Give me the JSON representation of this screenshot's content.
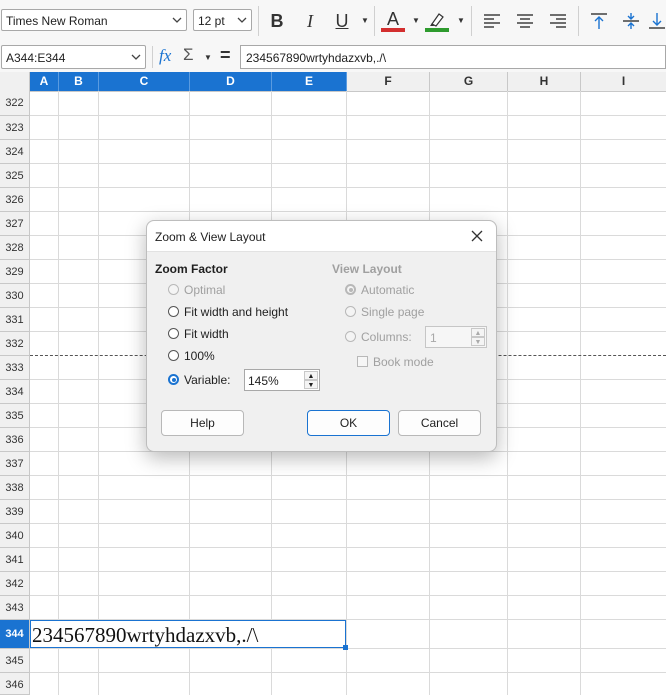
{
  "toolbar": {
    "font_name": "Times New Roman",
    "font_size": "12 pt",
    "bold_label": "B",
    "italic_label": "I",
    "underline_label": "U",
    "font_color_label": "A",
    "font_color": "#d32f2f",
    "highlight_color": "#2e9b2e"
  },
  "formula_bar": {
    "name_box": "A344:E344",
    "fx_label": "fx",
    "sum_label": "Σ",
    "equals_label": "=",
    "content": "234567890wrtyhdazxvb,./\\"
  },
  "grid": {
    "columns": [
      "A",
      "B",
      "C",
      "D",
      "E",
      "F",
      "G",
      "H",
      "I"
    ],
    "selected_columns": [
      "A",
      "B",
      "C",
      "D",
      "E"
    ],
    "rows": [
      "322",
      "323",
      "324",
      "325",
      "326",
      "327",
      "328",
      "329",
      "330",
      "331",
      "332",
      "333",
      "334",
      "335",
      "336",
      "337",
      "338",
      "339",
      "340",
      "341",
      "342",
      "343",
      "344",
      "345",
      "346"
    ],
    "selected_row": "344",
    "cell_text": "234567890wrtyhdazxvb,./\\"
  },
  "dialog": {
    "title": "Zoom & View Layout",
    "zoom_factor_heading": "Zoom Factor",
    "view_layout_heading": "View Layout",
    "zoom_options": {
      "optimal": "Optimal",
      "fit_width_height": "Fit width and height",
      "fit_width": "Fit width",
      "percent_100": "100%",
      "variable": "Variable:"
    },
    "variable_value": "145%",
    "selected_zoom": "variable",
    "view_options": {
      "automatic": "Automatic",
      "single_page": "Single page",
      "columns": "Columns:",
      "book_mode": "Book mode"
    },
    "columns_value": "1",
    "buttons": {
      "help": "Help",
      "ok": "OK",
      "cancel": "Cancel"
    }
  }
}
